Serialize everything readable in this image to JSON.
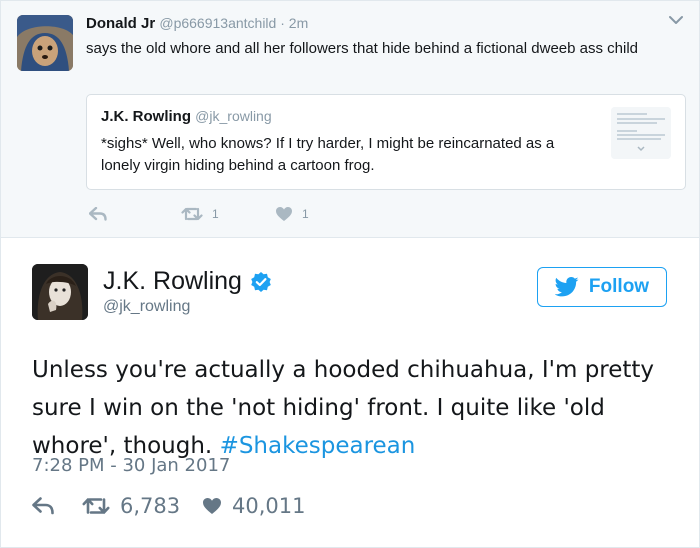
{
  "reply_tweet": {
    "name": "Donald Jr",
    "handle": "@p666913antchild",
    "separator": " · ",
    "time": "2m",
    "text": "says the old whore and all her followers that hide behind a fictional dweeb ass child",
    "quoted": {
      "name": "J.K. Rowling",
      "handle": "@jk_rowling",
      "text": "*sighs* Well, who knows? If I try harder, I might be reincarnated as a lonely virgin hiding behind a cartoon frog."
    },
    "retweets": "1",
    "likes": "1"
  },
  "main_tweet": {
    "name": "J.K. Rowling",
    "handle": "@jk_rowling",
    "follow_label": "Follow",
    "text": "Unless you're actually a hooded chihuahua, I'm pretty sure I win on the 'not hiding' front. I quite like 'old whore', though. ",
    "hashtag": "#Shakespearean",
    "timestamp": "7:28 PM - 30 Jan 2017",
    "retweets": "6,783",
    "likes": "40,011"
  },
  "colors": {
    "brand_blue": "#1da1f2",
    "hashtag_blue": "#1b95e0",
    "muted_gray": "#8899a6"
  }
}
